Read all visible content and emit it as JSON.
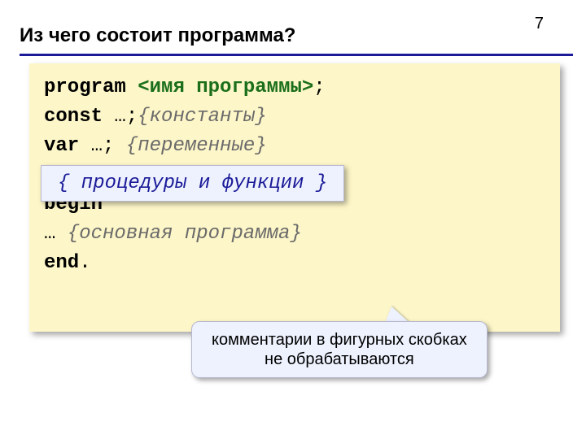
{
  "page_number": "7",
  "title": "Из чего состоит программа?",
  "code": {
    "l1_kw": "program",
    "l1_meta": "<имя программы>",
    "l1_end": ";",
    "l2_kw": "const",
    "l2_txt": " …;",
    "l2_comment": "{константы}",
    "l3_kw": "var",
    "l3_txt": " …; ",
    "l3_comment": "{переменные}",
    "l5_kw": "begin",
    "l6_txt": " … ",
    "l6_comment": "{основная программа}",
    "l7_kw": "end",
    "l7_end": "."
  },
  "inset": "{ процедуры и функции }",
  "callout_line1": "комментарии в фигурных скобках",
  "callout_line2": "не обрабатываются"
}
